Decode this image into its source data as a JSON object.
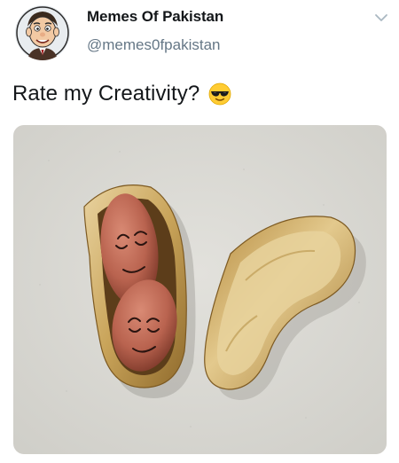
{
  "account": {
    "display_name": "Memes Of Pakistan",
    "handle": "@memes0fpakistan",
    "avatar_icon": "cartoon-face-avatar"
  },
  "tweet": {
    "text": "Rate my Creativity?",
    "emoji": "smiling-face-with-sunglasses-icon"
  },
  "media": {
    "description_icon": "peanut-shell-photo",
    "background": "#d9d8d3",
    "shell": "#c9a45a",
    "nut": "#b9634f"
  },
  "menu": {
    "icon": "chevron-down-icon"
  }
}
